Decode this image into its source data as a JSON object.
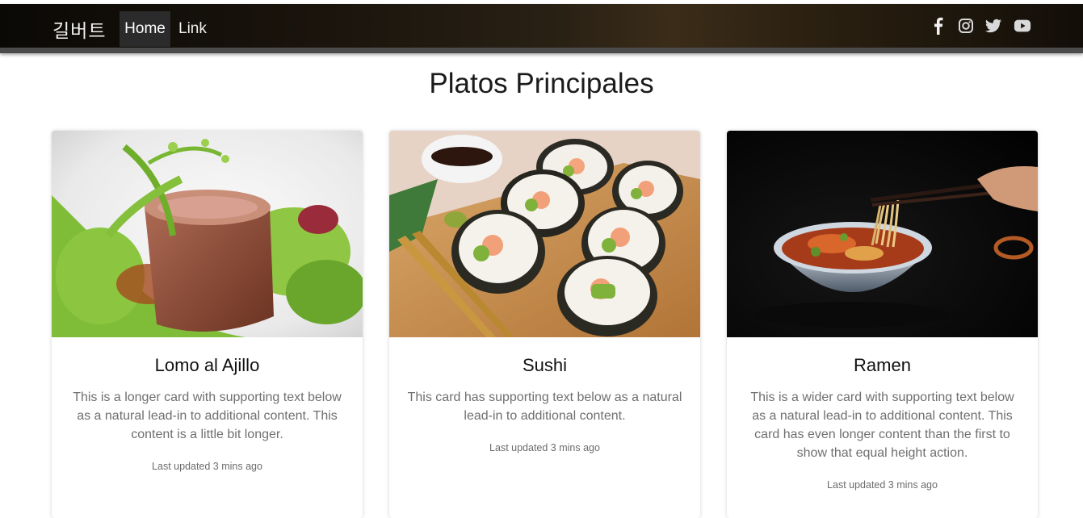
{
  "navbar": {
    "brand": "길버트",
    "items": [
      {
        "label": "Home",
        "active": true
      },
      {
        "label": "Link",
        "active": false
      }
    ],
    "social_icons": [
      "facebook-icon",
      "instagram-icon",
      "twitter-icon",
      "youtube-icon"
    ]
  },
  "main": {
    "title": "Platos Principales",
    "cards": [
      {
        "title": "Lomo al Ajillo",
        "text": "This is a longer card with supporting text below as a natural lead-in to additional content. This content is a little bit longer.",
        "meta": "Last updated 3 mins ago"
      },
      {
        "title": "Sushi",
        "text": "This card has supporting text below as a natural lead-in to additional content.",
        "meta": "Last updated 3 mins ago"
      },
      {
        "title": "Ramen",
        "text": "This is a wider card with supporting text below as a natural lead-in to additional content. This card has even longer content than the first to show that equal height action.",
        "meta": "Last updated 3 mins ago"
      }
    ]
  },
  "colors": {
    "navbar_bg": "#0b0906",
    "navbar_border": "#4b4b4b",
    "active_nav_bg": "#2b2b2b",
    "text_muted": "#6f6f6f"
  }
}
